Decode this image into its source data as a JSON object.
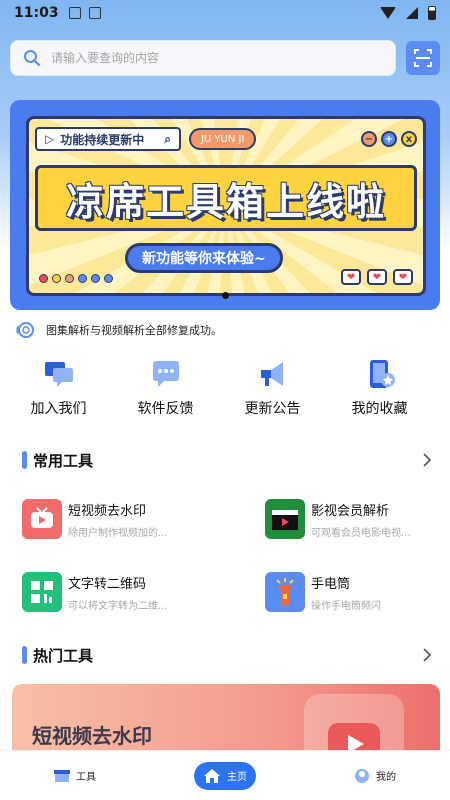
{
  "status_bar": {
    "time": "11:03"
  },
  "search": {
    "placeholder": "请输入要查询的内容"
  },
  "banner": {
    "pill_text": "功能持续更新中",
    "tag_text": "JU YUN JI",
    "title": "凉席工具箱上线啦",
    "subtitle": "新功能等你来体验~",
    "ctrl_minus": "−",
    "ctrl_plus": "+",
    "ctrl_close": "x",
    "heart": "❤"
  },
  "notice": {
    "text": "图集解析与视频解析全部修复成功。"
  },
  "quick_actions": [
    {
      "label": "加入我们",
      "icon": "chat-bubbles-icon"
    },
    {
      "label": "软件反馈",
      "icon": "feedback-icon"
    },
    {
      "label": "更新公告",
      "icon": "megaphone-icon"
    },
    {
      "label": "我的收藏",
      "icon": "phone-star-icon"
    }
  ],
  "common_tools": {
    "title": "常用工具",
    "items": [
      {
        "name": "短视频去水印",
        "desc": "除用户制作视频加的...",
        "color": "#f36b6b"
      },
      {
        "name": "影视会员解析",
        "desc": "可观看会员电影电视...",
        "color": "#1f8f3a"
      },
      {
        "name": "文字转二维码",
        "desc": "可以将文字转为二维...",
        "color": "#22c07a"
      },
      {
        "name": "手电筒",
        "desc": "操作手电筒频闪",
        "color": "#5a8cf2"
      }
    ]
  },
  "hot_tools": {
    "title": "热门工具",
    "card_title": "短视频去水印"
  },
  "bottom_nav": {
    "tools": "工具",
    "home": "主页",
    "mine": "我的"
  },
  "colors": {
    "accent": "#2d74f5",
    "section_bar": "#5a8cf2"
  }
}
